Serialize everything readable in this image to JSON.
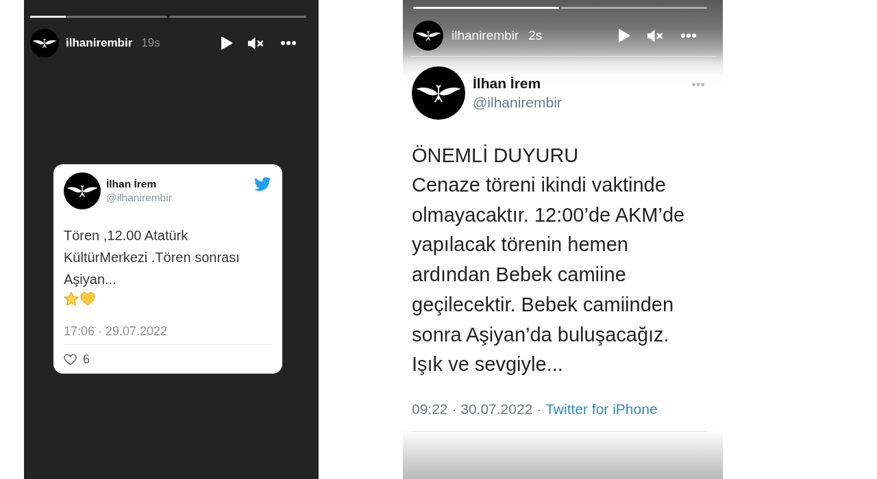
{
  "stories": [
    {
      "kind": "card",
      "progress": [
        {
          "kind": "current",
          "level": 0.26
        },
        {
          "kind": "unseen"
        }
      ],
      "header": {
        "username": "ilhanirembir",
        "age": "19s"
      },
      "tweet": {
        "name": "İlhan İrem",
        "handle": "@ilhanirembir",
        "text": "Tören ,12.00 Atatürk KültürMerkezi .Tören sonrası Aşiyan...",
        "timestamp": "17:06 · 29.07.2022",
        "likes": "6"
      }
    },
    {
      "kind": "screenshot",
      "progress": [
        {
          "kind": "seen"
        },
        {
          "kind": "unseen"
        }
      ],
      "header": {
        "username": "ilhanirembir",
        "age": "2s"
      },
      "tweet": {
        "name": "İlhan İrem",
        "handle": "@ilhanirembir",
        "heading": "ÖNEMLİ DUYURU",
        "text": "Cenaze töreni ikindi vaktinde olmayacaktır. 12:00’de AKM’de yapılacak törenin hemen ardından Bebek camiine geçilecektir. Bebek camiinden sonra Aşiyan’da buluşacağız. Işık ve sevgiyle...",
        "timestamp": "09:22 · 30.07.2022 ·",
        "source": "Twitter for iPhone"
      }
    }
  ]
}
